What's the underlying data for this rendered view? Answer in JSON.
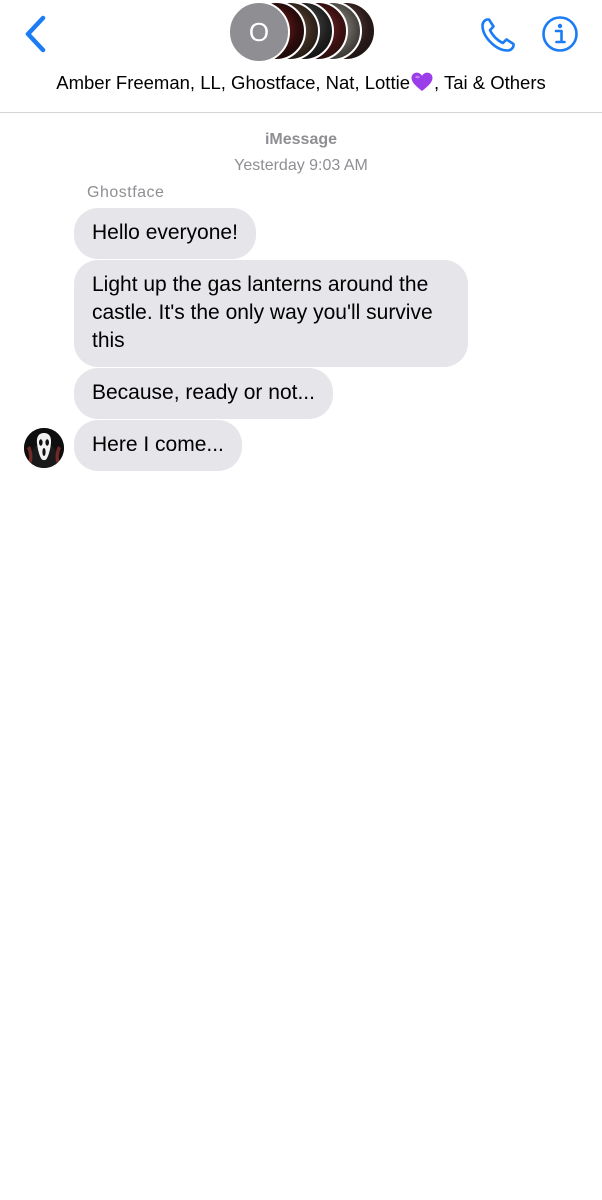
{
  "header": {
    "back_icon": "chevron-left-icon",
    "avatar_initial": "O",
    "group_names_before_emoji": "Amber Freeman, LL, Ghostface, Nat, Lottie",
    "group_names_after_emoji": ", Tai & Others",
    "emoji": "purple-heart-icon",
    "call_icon": "phone-icon",
    "info_icon": "info-icon"
  },
  "conversation": {
    "service_label": "iMessage",
    "timestamp": "Yesterday 9:03 AM",
    "sender": "Ghostface",
    "messages": [
      {
        "text": "Hello everyone!"
      },
      {
        "text": "Light up the gas lanterns around the castle. It's the only way you'll survive this"
      },
      {
        "text": "Because, ready or not..."
      },
      {
        "text": "Here I come..."
      }
    ]
  },
  "colors": {
    "accent": "#1b7cf6",
    "bubble_incoming": "#e5e5ea",
    "meta_text": "#8e8e93",
    "heart": "#9b3de8"
  }
}
